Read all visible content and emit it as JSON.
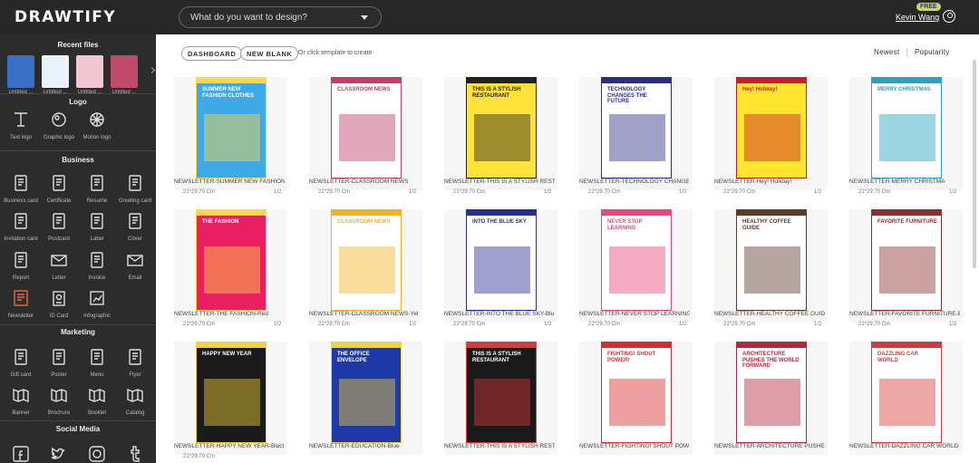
{
  "app": {
    "logo": "DRAWTIFY"
  },
  "search": {
    "placeholder": "What do you want to design?"
  },
  "user": {
    "name": "Kevin Wang",
    "badge": "FREE"
  },
  "sidebar": {
    "recent_title": "Recent files",
    "recent": [
      {
        "label": "Untitled ...",
        "color": "#3a6fc7"
      },
      {
        "label": "Untitled ...",
        "color": "#e9f1fb"
      },
      {
        "label": "Untitled ...",
        "color": "#f3c6d3"
      },
      {
        "label": "Untitled ...",
        "color": "#c04a6b"
      }
    ],
    "sections": [
      {
        "title": "Logo",
        "items": [
          {
            "label": "Text logo",
            "icon": "text-logo-icon"
          },
          {
            "label": "Graphic logo",
            "icon": "graphic-logo-icon"
          },
          {
            "label": "Motion logo",
            "icon": "motion-logo-icon"
          }
        ]
      },
      {
        "title": "Business",
        "items": [
          {
            "label": "Business card",
            "icon": "business-card-icon"
          },
          {
            "label": "Certificate",
            "icon": "certificate-icon"
          },
          {
            "label": "Resume",
            "icon": "resume-icon"
          },
          {
            "label": "Greeting card",
            "icon": "greeting-card-icon"
          },
          {
            "label": "Invitation card",
            "icon": "invitation-card-icon"
          },
          {
            "label": "Postcard",
            "icon": "postcard-icon"
          },
          {
            "label": "Label",
            "icon": "label-icon"
          },
          {
            "label": "Cover",
            "icon": "cover-icon"
          },
          {
            "label": "Report",
            "icon": "report-icon"
          },
          {
            "label": "Letter",
            "icon": "letter-icon"
          },
          {
            "label": "Invoice",
            "icon": "invoice-icon"
          },
          {
            "label": "Email",
            "icon": "email-icon"
          },
          {
            "label": "Newsletter",
            "icon": "newsletter-icon"
          },
          {
            "label": "ID Card",
            "icon": "id-card-icon"
          },
          {
            "label": "Infographic",
            "icon": "infographic-icon"
          }
        ]
      },
      {
        "title": "Marketing",
        "items": [
          {
            "label": "Gift card",
            "icon": "gift-card-icon"
          },
          {
            "label": "Poster",
            "icon": "poster-icon"
          },
          {
            "label": "Menu",
            "icon": "menu-icon"
          },
          {
            "label": "Flyer",
            "icon": "flyer-icon"
          },
          {
            "label": "Banner",
            "icon": "banner-icon"
          },
          {
            "label": "Brochure",
            "icon": "brochure-icon"
          },
          {
            "label": "Booklet",
            "icon": "booklet-icon"
          },
          {
            "label": "Catalog",
            "icon": "catalog-icon"
          }
        ]
      },
      {
        "title": "Social Media",
        "items": [
          {
            "label": "",
            "icon": "facebook-icon"
          },
          {
            "label": "",
            "icon": "twitter-icon"
          },
          {
            "label": "",
            "icon": "instagram-icon"
          },
          {
            "label": "",
            "icon": "tumblr-icon"
          }
        ]
      }
    ]
  },
  "main": {
    "dashboard_label": "DASHBOARD",
    "new_blank_label": "NEW BLANK",
    "hint": "Or click template to create",
    "sort_newest": "Newest",
    "sort_popularity": "Popularity",
    "templates": [
      {
        "title": "NEWSLETTER-SUMMER NEW FASHION",
        "size": "21*29.70 Cm",
        "pages": "1/2",
        "bg": "#3da9e6",
        "accent": "#ffd84a",
        "text": "SUMMER NEW FASHION CLOTHES"
      },
      {
        "title": "NEWSLETTER-CLASSROOM NEWS",
        "size": "21*29.70 Cm",
        "pages": "1/2",
        "bg": "#ffffff",
        "accent": "#c23b6b",
        "text": "CLASSROOM NEWS"
      },
      {
        "title": "NEWSLETTER-THIS IS A STYLISH REST",
        "size": "21*29.70 Cm",
        "pages": "1/2",
        "bg": "#ffe33a",
        "accent": "#222222",
        "text": "THIS IS A STYLISH RESTAURANT"
      },
      {
        "title": "NEWSLETTER-TECHNOLOGY CHANGE",
        "size": "21*29.70 Cm",
        "pages": "1/2",
        "bg": "#ffffff",
        "accent": "#2c2e82",
        "text": "TECHNOLOGY CHANGES THE FUTURE"
      },
      {
        "title": "NEWSLETTER-Hey! Holiday!",
        "size": "21*29.70 Cm",
        "pages": "1/2",
        "bg": "#ffe52e",
        "accent": "#c41f2a",
        "text": "Hey! Holiday!"
      },
      {
        "title": "NEWSLETTER-MERRY CHRISTMA",
        "size": "21*29.70 Cm",
        "pages": "1/2",
        "bg": "#ffffff",
        "accent": "#27a2c2",
        "text": "MERRY CHRISTMAS"
      },
      {
        "title": "NEWSLETTER-THE FASHION-Red",
        "size": "21*29.70 Cm",
        "pages": "1/2",
        "bg": "#e91e63",
        "accent": "#ffd84a",
        "text": "THE FASHION"
      },
      {
        "title": "NEWSLETTER-CLASSROOM NEWS-Yel",
        "size": "21*29.70 Cm",
        "pages": "1/2",
        "bg": "#ffffff",
        "accent": "#f0b323",
        "text": "CLASSROOM NEWS"
      },
      {
        "title": "NEWSLETTER-INTO THE BLUE SKY-Blu",
        "size": "21*29.70 Cm",
        "pages": "1/2",
        "bg": "#ffffff",
        "accent": "#2a2f8f",
        "text": "INTO THE BLUE SKY"
      },
      {
        "title": "NEWSLETTER-NEVER STOP LEARNING",
        "size": "21*29.70 Cm",
        "pages": "1/2",
        "bg": "#ffffff",
        "accent": "#e8457a",
        "text": "NEVER STOP LEARNING"
      },
      {
        "title": "NEWSLETTER-HEALTHY COFFEE GUID",
        "size": "21*29.70 Cm",
        "pages": "1/2",
        "bg": "#ffffff",
        "accent": "#5a3b2a",
        "text": "HEALTHY COFFEE GUIDE"
      },
      {
        "title": "NEWSLETTER-FAVORITE FURNITURE-E",
        "size": "21*29.70 Cm",
        "pages": "1/2",
        "bg": "#ffffff",
        "accent": "#8c2f2f",
        "text": "FAVORITE FURNITURE"
      },
      {
        "title": "NEWSLETTER-HAPPY NEW YEAR-Blacl",
        "size": "21*29.70 Cm",
        "pages": "",
        "bg": "#1a1a1a",
        "accent": "#f2d23a",
        "text": "HAPPY NEW YEAR"
      },
      {
        "title": "NEWSLETTER-EDUCATION-Blue",
        "size": "",
        "pages": "",
        "bg": "#1f3aa8",
        "accent": "#f2d23a",
        "text": "THE OFFICE ENVELOPE"
      },
      {
        "title": "NEWSLETTER-THIS IS A STYLISH REST",
        "size": "",
        "pages": "",
        "bg": "#1a1a1a",
        "accent": "#d93a3a",
        "text": "THIS IS A STYLISH RESTAURANT"
      },
      {
        "title": "NEWSLETTER-FIGHTING! SHOUT POW",
        "size": "",
        "pages": "",
        "bg": "#ffffff",
        "accent": "#d92b2b",
        "text": "FIGHTING! SHOUT POWER!"
      },
      {
        "title": "NEWSLETTER-ARCHITECTURE PUSHE",
        "size": "",
        "pages": "",
        "bg": "#ffffff",
        "accent": "#b3283e",
        "text": "ARCHITECTURE PUSHES THE WORLD FORWARD"
      },
      {
        "title": "NEWSLETTER-DAZZLING CAR WORLD",
        "size": "",
        "pages": "",
        "bg": "#ffffff",
        "accent": "#d63b3b",
        "text": "DAZZLING CAR WORLD"
      }
    ]
  }
}
